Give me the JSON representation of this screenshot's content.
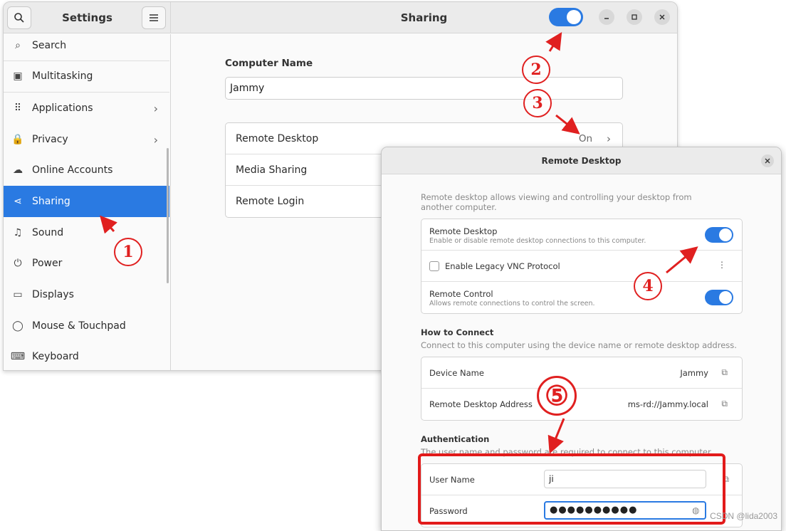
{
  "settings": {
    "title": "Settings",
    "page_title": "Sharing",
    "sidebar": [
      {
        "label": "Search",
        "icon": "search-icon",
        "glyph": "⌕"
      },
      {
        "label": "Multitasking",
        "icon": "multitasking-icon",
        "glyph": "▣"
      },
      {
        "label": "Applications",
        "icon": "apps-grid-icon",
        "glyph": "⠿",
        "chevron": true
      },
      {
        "label": "Privacy",
        "icon": "lock-icon",
        "glyph": "🔒",
        "chevron": true
      },
      {
        "label": "Online Accounts",
        "icon": "cloud-icon",
        "glyph": "☁"
      },
      {
        "label": "Sharing",
        "icon": "share-icon",
        "glyph": "⋖",
        "active": true
      },
      {
        "label": "Sound",
        "icon": "music-note-icon",
        "glyph": "♫"
      },
      {
        "label": "Power",
        "icon": "power-icon",
        "glyph": "⏻"
      },
      {
        "label": "Displays",
        "icon": "display-icon",
        "glyph": "▭"
      },
      {
        "label": "Mouse & Touchpad",
        "icon": "mouse-icon",
        "glyph": "◯"
      },
      {
        "label": "Keyboard",
        "icon": "keyboard-icon",
        "glyph": "⌨"
      }
    ],
    "computer_name_label": "Computer Name",
    "computer_name_value": "Jammy",
    "sharing_rows": [
      {
        "label": "Remote Desktop",
        "status": "On"
      },
      {
        "label": "Media Sharing",
        "status": ""
      },
      {
        "label": "Remote Login",
        "status": ""
      }
    ]
  },
  "dialog": {
    "title": "Remote Desktop",
    "intro": "Remote desktop allows viewing and controlling your desktop from another computer.",
    "remote_desktop_title": "Remote Desktop",
    "remote_desktop_sub": "Enable or disable remote desktop connections to this computer.",
    "legacy_vnc_label": "Enable Legacy VNC Protocol",
    "remote_control_title": "Remote Control",
    "remote_control_sub": "Allows remote connections to control the screen.",
    "how_to_connect_title": "How to Connect",
    "how_to_connect_sub": "Connect to this computer using the device name or remote desktop address.",
    "device_name_label": "Device Name",
    "device_name_value": "Jammy",
    "address_label": "Remote Desktop Address",
    "address_value": "ms-rd://Jammy.local",
    "auth_title": "Authentication",
    "auth_sub": "The user name and password are required to connect to this computer.",
    "user_name_label": "User Name",
    "user_name_value": "ji",
    "password_label": "Password",
    "password_value": "●●●●●●●●●●"
  },
  "annotations": {
    "one": "1",
    "two": "2",
    "three": "3",
    "four": "4",
    "five": "⑤"
  },
  "watermark": "CSDN @lida2003",
  "colors": {
    "accent": "#2a7ae2",
    "annotation": "#e02020"
  }
}
